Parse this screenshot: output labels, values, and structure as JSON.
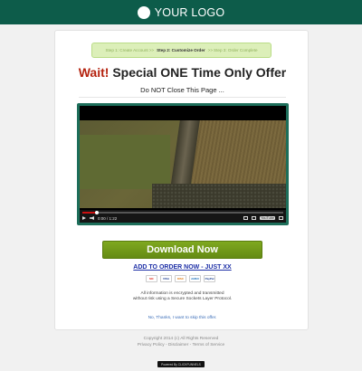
{
  "header": {
    "logo_text": "YOUR LOGO",
    "bg_color": "#0d5c4a"
  },
  "steps": {
    "step1": "Step 1: Create Account",
    "separator": ">>",
    "step2": "Step 2: Customize Order",
    "step3": "Step 3: Order Complete"
  },
  "headline": {
    "wait": "Wait!",
    "rest": "Special ONE Time Only Offer"
  },
  "subhead": "Do NOT Close This Page ...",
  "video": {
    "time": "0:00 / 1:22",
    "progress": 0.07,
    "youtube_label": "YouTube"
  },
  "cta": {
    "label": "Download Now",
    "color": "#6f9a18"
  },
  "order_link": "ADD TO ORDER NOW - JUST XX",
  "payment_cards": [
    "MC",
    "VISA",
    "DISC",
    "AMEX",
    "PayPal"
  ],
  "secure_text": {
    "line1": "All information is encrypted and transmitted",
    "line2": "without risk using a Secure Sockets Layer Protocol."
  },
  "no_thanks": "No, Thanks, I want to skip this offer.",
  "footer": {
    "copyright": "Copyright 2014 (c) All Rights Reserved",
    "links": "Privacy Policy - Disclaimer - Terms of Service"
  },
  "powered_by": "Powered By CLICKFUNNELS"
}
